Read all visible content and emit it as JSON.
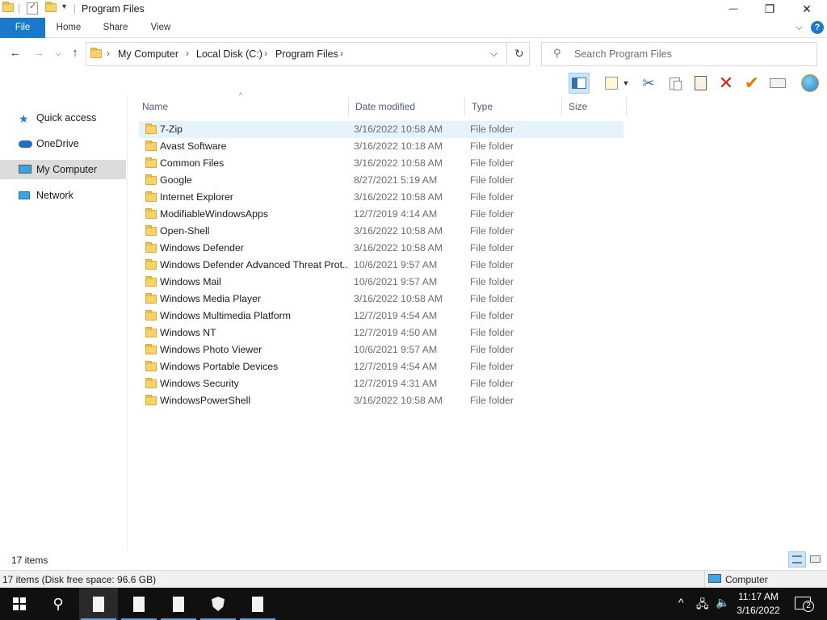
{
  "window": {
    "title": "Program Files",
    "minimize_glyph": "—",
    "maximize_glyph": "❐",
    "close_glyph": "✕"
  },
  "ribbon": {
    "tabs": [
      "File",
      "Home",
      "Share",
      "View"
    ],
    "expand_glyph": "⌵",
    "help_glyph": "?"
  },
  "address": {
    "crumbs": [
      "My Computer",
      "Local Disk (C:)",
      "Program Files"
    ],
    "search_placeholder": "Search Program Files"
  },
  "nav_pane": {
    "items": [
      {
        "label": "Quick access",
        "icon": "star-icon"
      },
      {
        "label": "OneDrive",
        "icon": "cloud-icon"
      },
      {
        "label": "My Computer",
        "icon": "computer-icon",
        "selected": true
      },
      {
        "label": "Network",
        "icon": "network-icon"
      }
    ]
  },
  "columns": [
    "Name",
    "Date modified",
    "Type",
    "Size"
  ],
  "files": [
    {
      "name": "7-Zip",
      "date": "3/16/2022 10:58 AM",
      "type": "File folder",
      "selected": true
    },
    {
      "name": "Avast Software",
      "date": "3/16/2022 10:18 AM",
      "type": "File folder"
    },
    {
      "name": "Common Files",
      "date": "3/16/2022 10:58 AM",
      "type": "File folder"
    },
    {
      "name": "Google",
      "date": "8/27/2021 5:19 AM",
      "type": "File folder"
    },
    {
      "name": "Internet Explorer",
      "date": "3/16/2022 10:58 AM",
      "type": "File folder"
    },
    {
      "name": "ModifiableWindowsApps",
      "date": "12/7/2019 4:14 AM",
      "type": "File folder"
    },
    {
      "name": "Open-Shell",
      "date": "3/16/2022 10:58 AM",
      "type": "File folder"
    },
    {
      "name": "Windows Defender",
      "date": "3/16/2022 10:58 AM",
      "type": "File folder"
    },
    {
      "name": "Windows Defender Advanced Threat Prot...",
      "date": "10/6/2021 9:57 AM",
      "type": "File folder"
    },
    {
      "name": "Windows Mail",
      "date": "10/6/2021 9:57 AM",
      "type": "File folder"
    },
    {
      "name": "Windows Media Player",
      "date": "3/16/2022 10:58 AM",
      "type": "File folder"
    },
    {
      "name": "Windows Multimedia Platform",
      "date": "12/7/2019 4:54 AM",
      "type": "File folder"
    },
    {
      "name": "Windows NT",
      "date": "12/7/2019 4:50 AM",
      "type": "File folder"
    },
    {
      "name": "Windows Photo Viewer",
      "date": "10/6/2021 9:57 AM",
      "type": "File folder"
    },
    {
      "name": "Windows Portable Devices",
      "date": "12/7/2019 4:54 AM",
      "type": "File folder"
    },
    {
      "name": "Windows Security",
      "date": "12/7/2019 4:31 AM",
      "type": "File folder"
    },
    {
      "name": "WindowsPowerShell",
      "date": "3/16/2022 10:58 AM",
      "type": "File folder"
    }
  ],
  "status": {
    "item_count": "17 items",
    "disk_info": "17 items (Disk free space: 96.6 GB)",
    "location": "Computer"
  },
  "taskbar": {
    "time": "11:17 AM",
    "date": "3/16/2022",
    "notification_count": "2"
  },
  "colors": {
    "accent": "#1979ca",
    "selection": "#e5f3ff",
    "folder": "#f6d36b",
    "taskbar": "#101010"
  }
}
